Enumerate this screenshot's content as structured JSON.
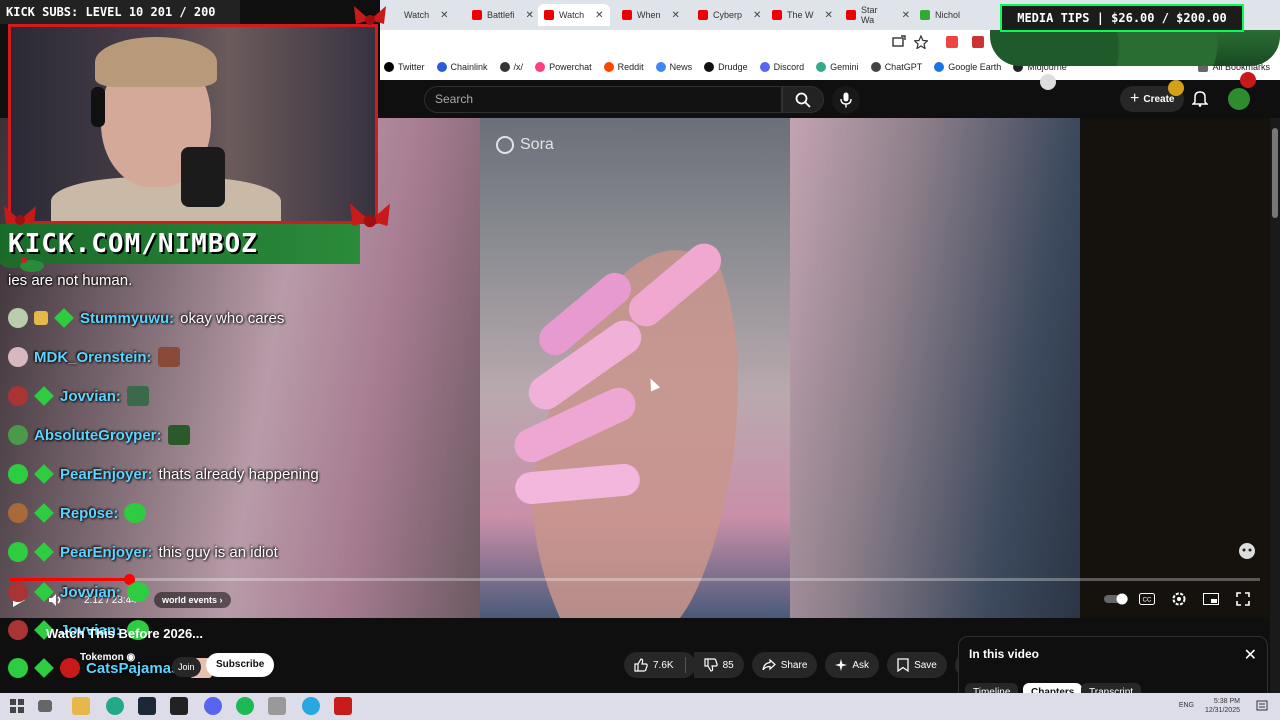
{
  "browser": {
    "tabs": [
      {
        "label": "Watch"
      },
      {
        "label": "Battlefi"
      },
      {
        "label": "Watch"
      },
      {
        "label": "When"
      },
      {
        "label": "Cyberp"
      },
      {
        "label": "The W"
      },
      {
        "label": "Star Wa"
      },
      {
        "label": "Nichol"
      }
    ],
    "bookmarks": [
      "Twitter",
      "Chainlink",
      "/x/",
      "Powerchat",
      "Reddit",
      "News",
      "Drudge",
      "Discord",
      "Gemini",
      "ChatGPT",
      "Google Earth",
      "Midjourne",
      "All Bookmarks"
    ]
  },
  "youtube": {
    "search_placeholder": "Search",
    "create_label": "Create"
  },
  "video": {
    "watermark": "Sora",
    "time": "2:12 / 23:44",
    "chapter": "world events",
    "progress": 0.095,
    "title": "Watch This Before 2026...",
    "channel": "Tokemon",
    "join_label": "Join",
    "subscribe_label": "Subscribe",
    "likes": "7.6K",
    "dislikes": "85",
    "share_label": "Share",
    "ask_label": "Ask",
    "save_label": "Save"
  },
  "in_this_video": {
    "title": "In this video",
    "tabs": [
      "Timeline",
      "Chapters",
      "Transcript"
    ],
    "active_tab": "Chapters"
  },
  "stream_overlay": {
    "kick_subs": "KICK SUBS: LEVEL 10 201 / 200",
    "kick_url": "KICK.COM/NIMBOZ",
    "media_tips": "MEDIA TIPS | $26.00 / $200.00"
  },
  "chat": [
    {
      "user": "",
      "message": "ies are not human."
    },
    {
      "user": "Stummyuwu:",
      "message": "okay who cares"
    },
    {
      "user": "MDK_Orenstein:",
      "message": ""
    },
    {
      "user": "Jovvian:",
      "message": ""
    },
    {
      "user": "AbsoluteGroyper:",
      "message": ""
    },
    {
      "user": "PearEnjoyer:",
      "message": "thats already happening"
    },
    {
      "user": "Rep0se:",
      "message": ""
    },
    {
      "user": "PearEnjoyer:",
      "message": "this guy is an idiot"
    },
    {
      "user": "Jovvian:",
      "message": ""
    },
    {
      "user": "Jovvian:",
      "message": ""
    },
    {
      "user": "CatsPajamas:",
      "message": ""
    }
  ],
  "taskbar": {
    "lang": "ENG",
    "time": "5:38 PM",
    "date": "12/31/2025"
  },
  "colors": {
    "accent_red": "#ff0000",
    "chat_name": "#5fd3ff",
    "kick_green": "#2ecc40"
  }
}
